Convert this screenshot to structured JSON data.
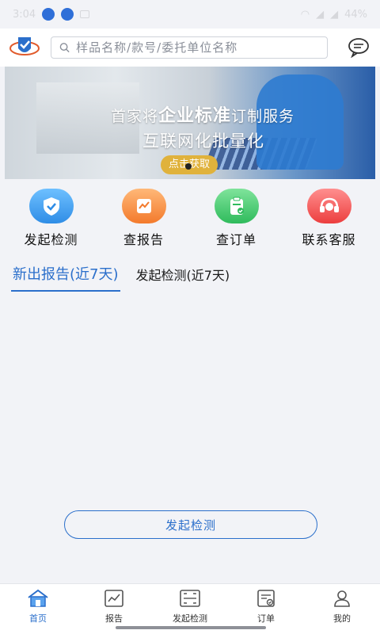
{
  "status_bar": {
    "time": "3:04",
    "battery": "44%"
  },
  "search": {
    "placeholder": "样品名称/款号/委托单位名称"
  },
  "banner": {
    "line1_pre": "首家将",
    "line1_bold": "企业标准",
    "line1_post": "订制服务",
    "line2": "互联网化批量化",
    "cta": "点击获取"
  },
  "actions": [
    {
      "label": "发起检测",
      "icon": "shield-check-icon",
      "color": "#2f8de6"
    },
    {
      "label": "查报告",
      "icon": "report-chart-icon",
      "color": "#f37a2c"
    },
    {
      "label": "查订单",
      "icon": "clipboard-check-icon",
      "color": "#2fbb5c"
    },
    {
      "label": "联系客服",
      "icon": "headset-icon",
      "color": "#ec3e3e"
    }
  ],
  "tabs": [
    {
      "label": "新出报告(近7天)",
      "active": true
    },
    {
      "label": "发起检测(近7天)",
      "active": false
    }
  ],
  "start_button": {
    "label": "发起检测"
  },
  "bottom_nav": [
    {
      "label": "首页",
      "icon": "home-icon",
      "active": true
    },
    {
      "label": "报告",
      "icon": "report-icon",
      "active": false
    },
    {
      "label": "发起检测",
      "icon": "scan-icon",
      "active": false
    },
    {
      "label": "订单",
      "icon": "order-icon",
      "active": false
    },
    {
      "label": "我的",
      "icon": "user-icon",
      "active": false
    }
  ],
  "colors": {
    "accent": "#2b6fcb",
    "background": "#f2f3f7"
  }
}
